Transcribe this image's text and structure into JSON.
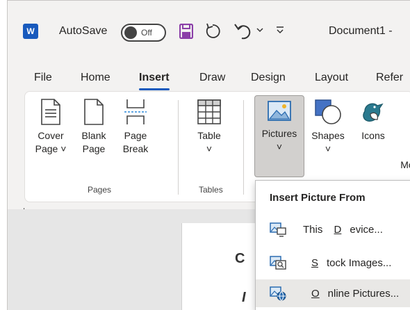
{
  "titlebar": {
    "app_icon": "W",
    "autosave_label": "AutoSave",
    "autosave_state": "Off",
    "document_title": "Document1 - "
  },
  "tabs": [
    {
      "label": "File",
      "active": false
    },
    {
      "label": "Home",
      "active": false
    },
    {
      "label": "Insert",
      "active": true
    },
    {
      "label": "Draw",
      "active": false
    },
    {
      "label": "Design",
      "active": false
    },
    {
      "label": "Layout",
      "active": false
    },
    {
      "label": "Refer",
      "active": false
    }
  ],
  "ribbon": {
    "cover_page": {
      "line1": "Cover",
      "line2": "Page ˅"
    },
    "blank_page": {
      "line1": "Blank",
      "line2": "Page"
    },
    "page_break": {
      "line1": "Page",
      "line2": "Break"
    },
    "pages_group": "Pages",
    "table": {
      "line1": "Table",
      "line2": "˅"
    },
    "tables_group": "Tables",
    "pictures": {
      "line1": "Pictures",
      "line2": "˅"
    },
    "shapes": {
      "line1": "Shapes",
      "line2": "˅"
    },
    "icons": {
      "line1": "Icons"
    },
    "truncated_label": "Mo"
  },
  "ruler_mark": "L",
  "page_chars": [
    "C",
    "I"
  ],
  "dropdown": {
    "header": "Insert Picture From",
    "items": [
      {
        "pre": "This ",
        "key": "D",
        "post": "evice...",
        "icon": "this-device-icon"
      },
      {
        "pre": "",
        "key": "S",
        "post": "tock Images...",
        "icon": "stock-images-icon"
      },
      {
        "pre": "",
        "key": "O",
        "post": "nline Pictures...",
        "icon": "online-pictures-icon"
      }
    ]
  },
  "colors": {
    "word_blue": "#185abd",
    "save_purple": "#8b3fa8",
    "icons_teal": "#2b7a8f",
    "shape_blue": "#4472c4"
  }
}
